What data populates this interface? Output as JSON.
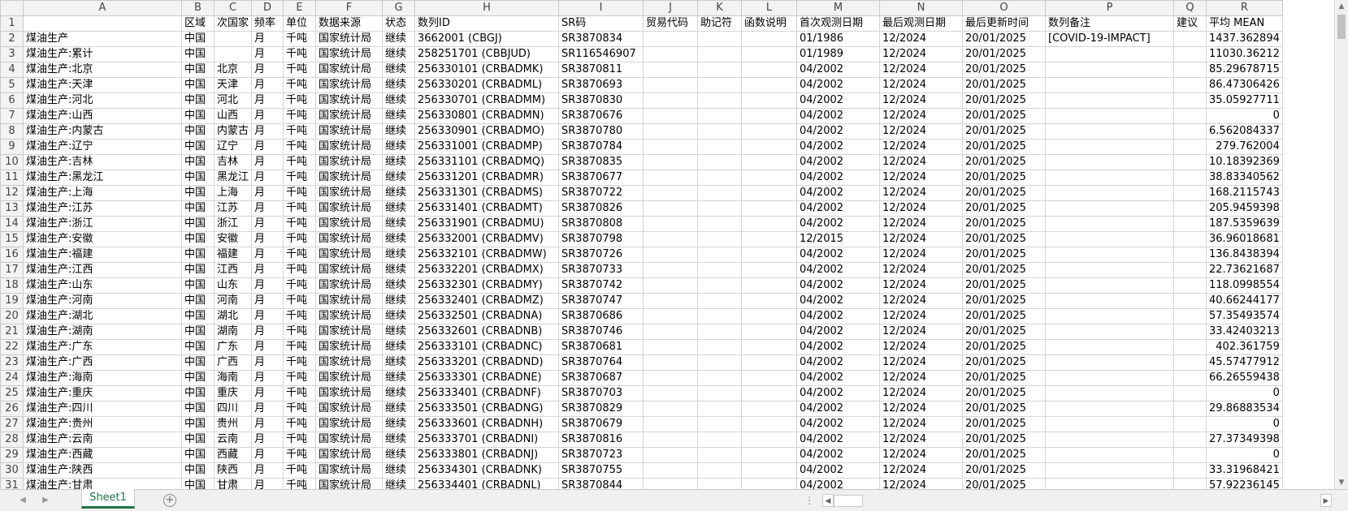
{
  "columns": [
    "A",
    "B",
    "C",
    "D",
    "E",
    "F",
    "G",
    "H",
    "I",
    "J",
    "K",
    "L",
    "M",
    "N",
    "O",
    "P",
    "Q",
    "R"
  ],
  "header_row": {
    "row": "1",
    "cells": [
      "",
      "区域",
      "次国家",
      "频率",
      "单位",
      "数据来源",
      "状态",
      "数列ID",
      "SR码",
      "贸易代码",
      "助记符",
      "函数说明",
      "首次观测日期",
      "最后观测日期",
      "最后更新时间",
      "数列备注",
      "建议",
      "平均 MEAN"
    ]
  },
  "rows": [
    {
      "row": "2",
      "cells": [
        "煤油生产",
        "中国",
        "",
        "月",
        "千吨",
        "国家统计局",
        "继续",
        "3662001 (CBGJ)",
        "SR3870834",
        "",
        "",
        "",
        "01/1986",
        "12/2024",
        "20/01/2025",
        "[COVID-19-IMPACT]",
        "",
        "1437.362894"
      ]
    },
    {
      "row": "3",
      "cells": [
        "煤油生产:累计",
        "中国",
        "",
        "月",
        "千吨",
        "国家统计局",
        "继续",
        "258251701 (CBBJUD)",
        "SR116546907",
        "",
        "",
        "",
        "01/1989",
        "12/2024",
        "20/01/2025",
        "",
        "",
        "11030.36212"
      ]
    },
    {
      "row": "4",
      "cells": [
        "煤油生产:北京",
        "中国",
        "北京",
        "月",
        "千吨",
        "国家统计局",
        "继续",
        "256330101 (CRBADMK)",
        "SR3870811",
        "",
        "",
        "",
        "04/2002",
        "12/2024",
        "20/01/2025",
        "",
        "",
        "85.29678715"
      ]
    },
    {
      "row": "5",
      "cells": [
        "煤油生产:天津",
        "中国",
        "天津",
        "月",
        "千吨",
        "国家统计局",
        "继续",
        "256330201 (CRBADML)",
        "SR3870693",
        "",
        "",
        "",
        "04/2002",
        "12/2024",
        "20/01/2025",
        "",
        "",
        "86.47306426"
      ]
    },
    {
      "row": "6",
      "cells": [
        "煤油生产:河北",
        "中国",
        "河北",
        "月",
        "千吨",
        "国家统计局",
        "继续",
        "256330701 (CRBADMM)",
        "SR3870830",
        "",
        "",
        "",
        "04/2002",
        "12/2024",
        "20/01/2025",
        "",
        "",
        "35.05927711"
      ]
    },
    {
      "row": "7",
      "cells": [
        "煤油生产:山西",
        "中国",
        "山西",
        "月",
        "千吨",
        "国家统计局",
        "继续",
        "256330801 (CRBADMN)",
        "SR3870676",
        "",
        "",
        "",
        "04/2002",
        "12/2024",
        "20/01/2025",
        "",
        "",
        "0"
      ]
    },
    {
      "row": "8",
      "cells": [
        "煤油生产:内蒙古",
        "中国",
        "内蒙古",
        "月",
        "千吨",
        "国家统计局",
        "继续",
        "256330901 (CRBADMO)",
        "SR3870780",
        "",
        "",
        "",
        "04/2002",
        "12/2024",
        "20/01/2025",
        "",
        "",
        "6.562084337"
      ]
    },
    {
      "row": "9",
      "cells": [
        "煤油生产:辽宁",
        "中国",
        "辽宁",
        "月",
        "千吨",
        "国家统计局",
        "继续",
        "256331001 (CRBADMP)",
        "SR3870784",
        "",
        "",
        "",
        "04/2002",
        "12/2024",
        "20/01/2025",
        "",
        "",
        "279.762004"
      ]
    },
    {
      "row": "10",
      "cells": [
        "煤油生产:吉林",
        "中国",
        "吉林",
        "月",
        "千吨",
        "国家统计局",
        "继续",
        "256331101 (CRBADMQ)",
        "SR3870835",
        "",
        "",
        "",
        "04/2002",
        "12/2024",
        "20/01/2025",
        "",
        "",
        "10.18392369"
      ]
    },
    {
      "row": "11",
      "cells": [
        "煤油生产:黑龙江",
        "中国",
        "黑龙江",
        "月",
        "千吨",
        "国家统计局",
        "继续",
        "256331201 (CRBADMR)",
        "SR3870677",
        "",
        "",
        "",
        "04/2002",
        "12/2024",
        "20/01/2025",
        "",
        "",
        "38.83340562"
      ]
    },
    {
      "row": "12",
      "cells": [
        "煤油生产:上海",
        "中国",
        "上海",
        "月",
        "千吨",
        "国家统计局",
        "继续",
        "256331301 (CRBADMS)",
        "SR3870722",
        "",
        "",
        "",
        "04/2002",
        "12/2024",
        "20/01/2025",
        "",
        "",
        "168.2115743"
      ]
    },
    {
      "row": "13",
      "cells": [
        "煤油生产:江苏",
        "中国",
        "江苏",
        "月",
        "千吨",
        "国家统计局",
        "继续",
        "256331401 (CRBADMT)",
        "SR3870826",
        "",
        "",
        "",
        "04/2002",
        "12/2024",
        "20/01/2025",
        "",
        "",
        "205.9459398"
      ]
    },
    {
      "row": "14",
      "cells": [
        "煤油生产:浙江",
        "中国",
        "浙江",
        "月",
        "千吨",
        "国家统计局",
        "继续",
        "256331901 (CRBADMU)",
        "SR3870808",
        "",
        "",
        "",
        "04/2002",
        "12/2024",
        "20/01/2025",
        "",
        "",
        "187.5359639"
      ]
    },
    {
      "row": "15",
      "cells": [
        "煤油生产:安徽",
        "中国",
        "安徽",
        "月",
        "千吨",
        "国家统计局",
        "继续",
        "256332001 (CRBADMV)",
        "SR3870798",
        "",
        "",
        "",
        "12/2015",
        "12/2024",
        "20/01/2025",
        "",
        "",
        "36.96018681"
      ]
    },
    {
      "row": "16",
      "cells": [
        "煤油生产:福建",
        "中国",
        "福建",
        "月",
        "千吨",
        "国家统计局",
        "继续",
        "256332101 (CRBADMW)",
        "SR3870726",
        "",
        "",
        "",
        "04/2002",
        "12/2024",
        "20/01/2025",
        "",
        "",
        "136.8438394"
      ]
    },
    {
      "row": "17",
      "cells": [
        "煤油生产:江西",
        "中国",
        "江西",
        "月",
        "千吨",
        "国家统计局",
        "继续",
        "256332201 (CRBADMX)",
        "SR3870733",
        "",
        "",
        "",
        "04/2002",
        "12/2024",
        "20/01/2025",
        "",
        "",
        "22.73621687"
      ]
    },
    {
      "row": "18",
      "cells": [
        "煤油生产:山东",
        "中国",
        "山东",
        "月",
        "千吨",
        "国家统计局",
        "继续",
        "256332301 (CRBADMY)",
        "SR3870742",
        "",
        "",
        "",
        "04/2002",
        "12/2024",
        "20/01/2025",
        "",
        "",
        "118.0998554"
      ]
    },
    {
      "row": "19",
      "cells": [
        "煤油生产:河南",
        "中国",
        "河南",
        "月",
        "千吨",
        "国家统计局",
        "继续",
        "256332401 (CRBADMZ)",
        "SR3870747",
        "",
        "",
        "",
        "04/2002",
        "12/2024",
        "20/01/2025",
        "",
        "",
        "40.66244177"
      ]
    },
    {
      "row": "20",
      "cells": [
        "煤油生产:湖北",
        "中国",
        "湖北",
        "月",
        "千吨",
        "国家统计局",
        "继续",
        "256332501 (CRBADNA)",
        "SR3870686",
        "",
        "",
        "",
        "04/2002",
        "12/2024",
        "20/01/2025",
        "",
        "",
        "57.35493574"
      ]
    },
    {
      "row": "21",
      "cells": [
        "煤油生产:湖南",
        "中国",
        "湖南",
        "月",
        "千吨",
        "国家统计局",
        "继续",
        "256332601 (CRBADNB)",
        "SR3870746",
        "",
        "",
        "",
        "04/2002",
        "12/2024",
        "20/01/2025",
        "",
        "",
        "33.42403213"
      ]
    },
    {
      "row": "22",
      "cells": [
        "煤油生产:广东",
        "中国",
        "广东",
        "月",
        "千吨",
        "国家统计局",
        "继续",
        "256333101 (CRBADNC)",
        "SR3870681",
        "",
        "",
        "",
        "04/2002",
        "12/2024",
        "20/01/2025",
        "",
        "",
        "402.361759"
      ]
    },
    {
      "row": "23",
      "cells": [
        "煤油生产:广西",
        "中国",
        "广西",
        "月",
        "千吨",
        "国家统计局",
        "继续",
        "256333201 (CRBADND)",
        "SR3870764",
        "",
        "",
        "",
        "04/2002",
        "12/2024",
        "20/01/2025",
        "",
        "",
        "45.57477912"
      ]
    },
    {
      "row": "24",
      "cells": [
        "煤油生产:海南",
        "中国",
        "海南",
        "月",
        "千吨",
        "国家统计局",
        "继续",
        "256333301 (CRBADNE)",
        "SR3870687",
        "",
        "",
        "",
        "04/2002",
        "12/2024",
        "20/01/2025",
        "",
        "",
        "66.26559438"
      ]
    },
    {
      "row": "25",
      "cells": [
        "煤油生产:重庆",
        "中国",
        "重庆",
        "月",
        "千吨",
        "国家统计局",
        "继续",
        "256333401 (CRBADNF)",
        "SR3870703",
        "",
        "",
        "",
        "04/2002",
        "12/2024",
        "20/01/2025",
        "",
        "",
        "0"
      ]
    },
    {
      "row": "26",
      "cells": [
        "煤油生产:四川",
        "中国",
        "四川",
        "月",
        "千吨",
        "国家统计局",
        "继续",
        "256333501 (CRBADNG)",
        "SR3870829",
        "",
        "",
        "",
        "04/2002",
        "12/2024",
        "20/01/2025",
        "",
        "",
        "29.86883534"
      ]
    },
    {
      "row": "27",
      "cells": [
        "煤油生产:贵州",
        "中国",
        "贵州",
        "月",
        "千吨",
        "国家统计局",
        "继续",
        "256333601 (CRBADNH)",
        "SR3870679",
        "",
        "",
        "",
        "04/2002",
        "12/2024",
        "20/01/2025",
        "",
        "",
        "0"
      ]
    },
    {
      "row": "28",
      "cells": [
        "煤油生产:云南",
        "中国",
        "云南",
        "月",
        "千吨",
        "国家统计局",
        "继续",
        "256333701 (CRBADNI)",
        "SR3870816",
        "",
        "",
        "",
        "04/2002",
        "12/2024",
        "20/01/2025",
        "",
        "",
        "27.37349398"
      ]
    },
    {
      "row": "29",
      "cells": [
        "煤油生产:西藏",
        "中国",
        "西藏",
        "月",
        "千吨",
        "国家统计局",
        "继续",
        "256333801 (CRBADNJ)",
        "SR3870723",
        "",
        "",
        "",
        "04/2002",
        "12/2024",
        "20/01/2025",
        "",
        "",
        "0"
      ]
    },
    {
      "row": "30",
      "cells": [
        "煤油生产:陕西",
        "中国",
        "陕西",
        "月",
        "千吨",
        "国家统计局",
        "继续",
        "256334301 (CRBADNK)",
        "SR3870755",
        "",
        "",
        "",
        "04/2002",
        "12/2024",
        "20/01/2025",
        "",
        "",
        "33.31968421"
      ]
    },
    {
      "row": "31",
      "cells": [
        "煤油生产:甘肃",
        "中国",
        "甘肃",
        "月",
        "千吨",
        "国家统计局",
        "继续",
        "256334401 (CRBADNL)",
        "SR3870844",
        "",
        "",
        "",
        "04/2002",
        "12/2024",
        "20/01/2025",
        "",
        "",
        "57.92236145"
      ]
    }
  ],
  "sheet_tab": "Sheet1",
  "icons": {
    "add_sheet": "plus-circle-icon",
    "nav_prev": "triangle-left-icon",
    "nav_next": "triangle-right-icon"
  },
  "colors": {
    "accent": "#217346",
    "header_bg": "#f3f3f3",
    "gridline": "#d4d4d4"
  }
}
